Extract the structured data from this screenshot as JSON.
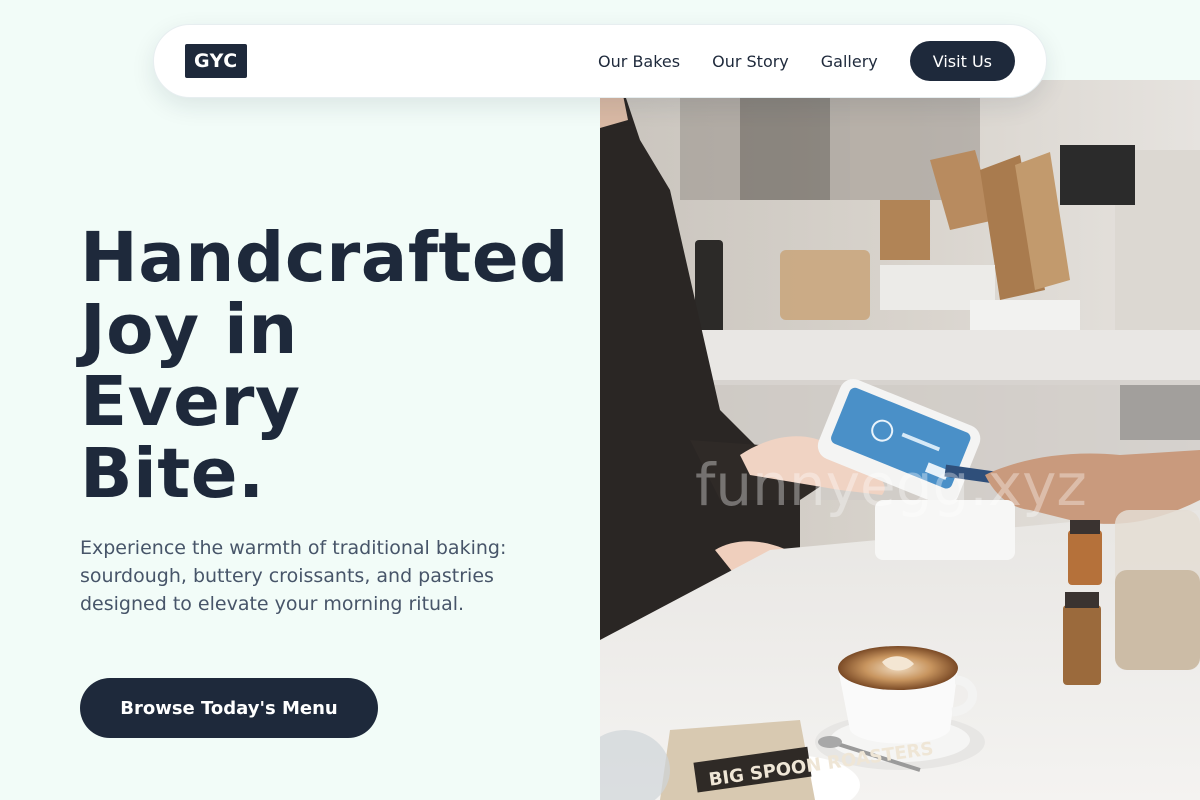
{
  "nav": {
    "logo": "GYC",
    "links": [
      "Our Bakes",
      "Our Story",
      "Gallery"
    ],
    "cta": "Visit Us"
  },
  "hero": {
    "headline_lines": [
      "Handcrafted",
      "Joy in",
      "Every",
      "Bite."
    ],
    "subtext": "Experience the warmth of traditional baking: sourdough, buttery croissants, and pastries designed to elevate your morning ritual.",
    "cta": "Browse Today's Menu",
    "image_alt": "Customer paying by card at a café counter with a latte",
    "watermark": "funnyegg.xyz",
    "bag_text": "BIG SPOON ROASTERS"
  },
  "colors": {
    "background": "#f2fcf8",
    "primary": "#1e293b",
    "body_text": "#475569"
  }
}
